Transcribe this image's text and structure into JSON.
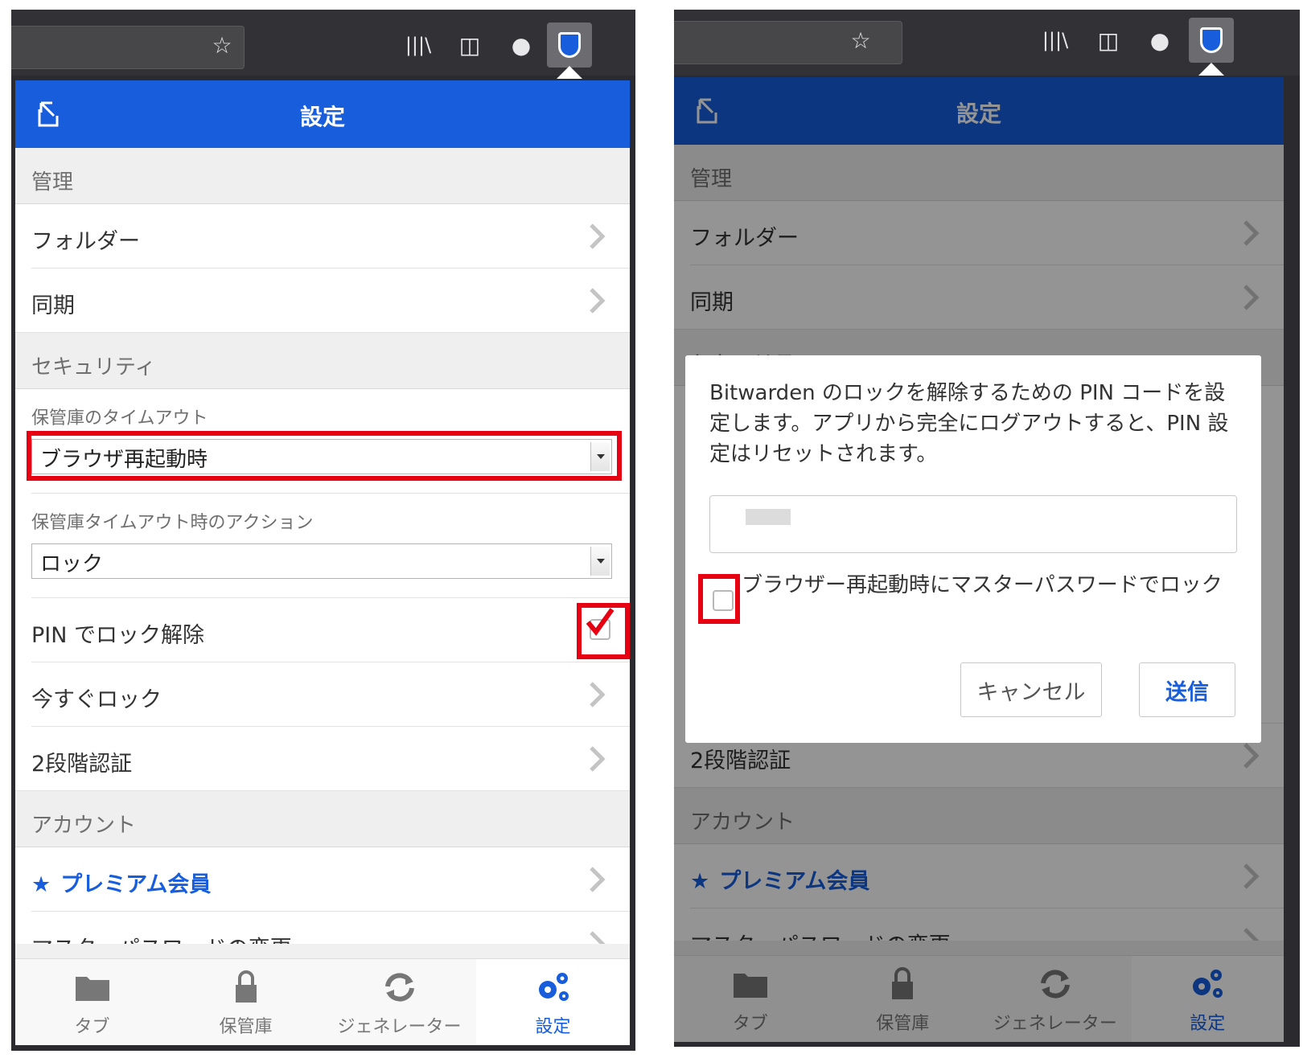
{
  "left": {
    "header": {
      "title": "設定"
    },
    "sections": {
      "manage": "管理",
      "security": "セキュリティ",
      "account": "アカウント"
    },
    "rows": {
      "folders": "フォルダー",
      "sync": "同期",
      "vault_timeout_label": "保管庫のタイムアウト",
      "vault_timeout_value": "ブラウザ再起動時",
      "timeout_action_label": "保管庫タイムアウト時のアクション",
      "timeout_action_value": "ロック",
      "pin_unlock": "PIN でロック解除",
      "lock_now": "今すぐロック",
      "two_step": "2段階認証",
      "premium": "プレミアム会員",
      "change_master": "マスターパスワードの変更"
    },
    "pin_checked": true
  },
  "right": {
    "header": {
      "title": "設定"
    },
    "sections": {
      "manage": "管理",
      "security": "セキュリティ",
      "account": "アカウント"
    },
    "rows": {
      "folders": "フォルダー",
      "sync": "同期",
      "two_step": "2段階認証",
      "premium": "プレミアム会員",
      "change_master": "マスターパスワードの変更"
    },
    "modal": {
      "message": "Bitwarden のロックを解除するための PIN コードを設定します。アプリから完全にログアウトすると、PIN 設定はリセットされます。",
      "checkbox_label": "ブラウザー再起動時にマスターパスワードでロック",
      "checkbox_checked": false,
      "cancel": "キャンセル",
      "submit": "送信"
    }
  },
  "tabs": {
    "tab": "タブ",
    "vault": "保管庫",
    "generator": "ジェネレーター",
    "settings": "設定"
  },
  "colors": {
    "brand": "#175ddc",
    "highlight": "#e60012"
  }
}
